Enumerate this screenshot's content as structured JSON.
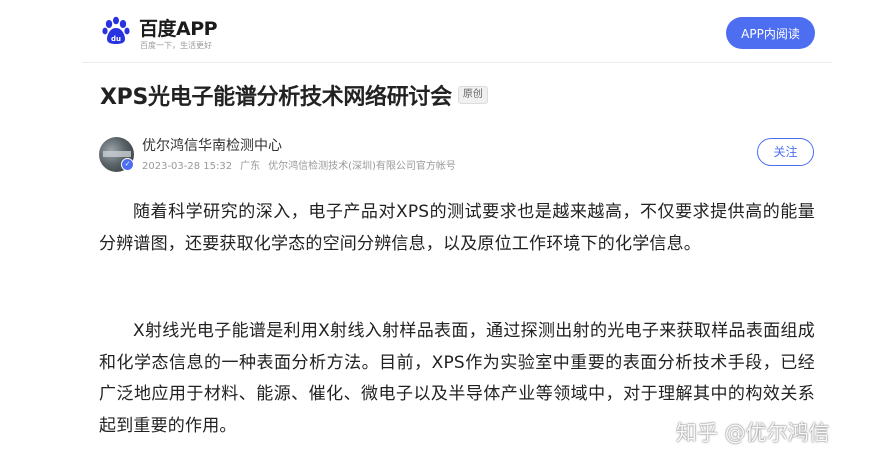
{
  "header": {
    "brand_name": "百度APP",
    "slogan": "百度一下，生活更好",
    "app_read_label": "APP内阅读",
    "brand_colors": {
      "accent": "#4e6ef2",
      "paw": "#2932e1"
    }
  },
  "article": {
    "title": "XPS光电子能谱分析技术网络研讨会",
    "original_badge": "原创",
    "author": {
      "name": "优尔鸿信华南检测中心",
      "date": "2023-03-28 15:32",
      "location": "广东",
      "account": "优尔鸿信检测技术(深圳)有限公司官方帐号",
      "follow_label": "关注"
    },
    "paragraphs": [
      "随着科学研究的深入，电子产品对XPS的测试要求也是越来越高，不仅要求提供高的能量分辨谱图，还要获取化学态的空间分辨信息，以及原位工作环境下的化学信息。",
      "X射线光电子能谱是利用X射线入射样品表面，通过探测出射的光电子来获取样品表面组成和化学态信息的一种表面分析方法。目前，XPS作为实验室中重要的表面分析技术手段，已经广泛地应用于材料、能源、催化、微电子以及半导体产业等领域中，对于理解其中的构效关系起到重要的作用。"
    ]
  },
  "watermark": "知乎 @优尔鸿信"
}
